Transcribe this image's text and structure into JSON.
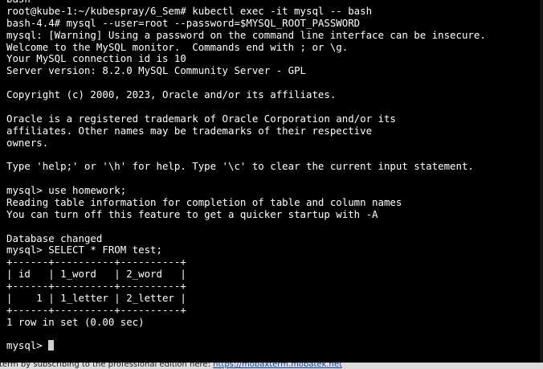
{
  "terminal": {
    "lines": [
      "bash",
      "root@kube-1:~/kubespray/6_Sem# kubectl exec -it mysql -- bash",
      "bash-4.4# mysql --user=root --password=$MYSQL_ROOT_PASSWORD",
      "mysql: [Warning] Using a password on the command line interface can be insecure.",
      "Welcome to the MySQL monitor.  Commands end with ; or \\g.",
      "Your MySQL connection id is 10",
      "Server version: 8.2.0 MySQL Community Server - GPL",
      "",
      "Copyright (c) 2000, 2023, Oracle and/or its affiliates.",
      "",
      "Oracle is a registered trademark of Oracle Corporation and/or its",
      "affiliates. Other names may be trademarks of their respective",
      "owners.",
      "",
      "Type 'help;' or '\\h' for help. Type '\\c' to clear the current input statement.",
      "",
      "mysql> use homework;",
      "Reading table information for completion of table and column names",
      "You can turn off this feature to get a quicker startup with -A",
      "",
      "Database changed",
      "mysql> SELECT * FROM test;",
      "+------+----------+----------+",
      "| id   | 1_word   | 2_word   |",
      "+------+----------+----------+",
      "|    1 | 1_letter | 2_letter |",
      "+------+----------+----------+",
      "1 row in set (0.00 sec)",
      "",
      "mysql> "
    ]
  },
  "status_bar": {
    "text": "term by subscribing to the professional edition here: ",
    "link": "https://mobaxterm.mobatek.net"
  }
}
